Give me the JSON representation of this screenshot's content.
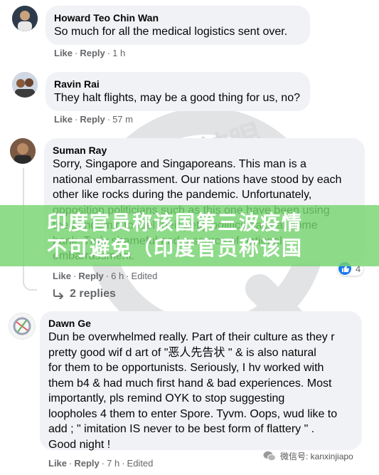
{
  "comments": [
    {
      "author": "Howard Teo Chin Wan",
      "text": "So much for all the medical logistics sent over.",
      "like": "Like",
      "reply": "Reply",
      "time": "1 h"
    },
    {
      "author": "Ravin Rai",
      "text": "They halt flights, may be a good thing for us, no?",
      "like": "Like",
      "reply": "Reply",
      "time": "57 m"
    },
    {
      "author": "Suman Ray",
      "text": "Sorry, Singapore and Singaporeans. This man is a\nnational embarrassment. Our nations have stood by each\nother like rocks during the pandemic. Unfortunately,\nopposition politicians such as this one have been using\nthe pandemic to fuel their petty politics back at home\nbank. Truly shameful and a source of national\nembarrassment.",
      "like": "Like",
      "reply": "Reply",
      "time": "6 h",
      "edited": "Edited",
      "reaction_count": "4"
    },
    {
      "author": "Dawn Ge",
      "text": "Dun be overwhelmed really. Part of their culture as they r\npretty good wif d art of \"恶人先告状 \" & is also natural\nfor them to be opportunists. Seriously, I hv worked with\nthem b4 & had much first hand & bad experiences. Most\nimportantly, pls remind OYK to stop suggesting\nloopholes 4 them to enter Spore. Tyvm. Oops, wud like to\nadd ; \" imitation IS never to be best form of flattery \" .\nGood night !",
      "like": "Like",
      "reply": "Reply",
      "time": "7 h",
      "edited": "Edited"
    }
  ],
  "replies_label": "2 replies",
  "banner": {
    "line1": "印度官员称该国第三波疫情",
    "line2": "不可避免（印度官员称该国"
  },
  "watermark_text": "新加坡眼",
  "wechat_label": "微信号: kanxinjiapo",
  "colors": {
    "bubble": "#f0f2f5",
    "meta": "#65676b",
    "banner": "#76d670",
    "watermark": "#d9dadc",
    "like_blue": "#1877f2"
  }
}
